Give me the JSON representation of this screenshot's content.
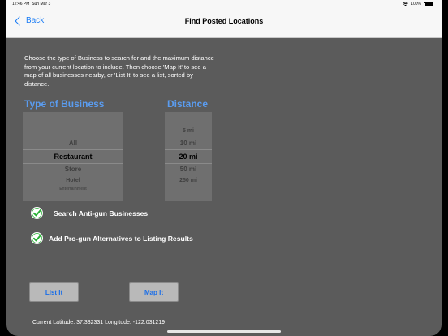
{
  "status_bar": {
    "time": "12:46 PM",
    "date": "Sun Mar 3",
    "wifi_icon": "wifi-icon",
    "battery_percent": "100%"
  },
  "nav": {
    "back_label": "Back",
    "title": "Find Posted Locations"
  },
  "instructions": "Choose the type of Business to search for and the maximum distance from your current location to include.  Then choose 'Map It' to see a map of all businesses nearby, or 'List It' to see a list, sorted by distance.",
  "business_picker": {
    "label": "Type of Business",
    "items": [
      "All",
      "Restaurant",
      "Store",
      "Hotel",
      "Entertainment"
    ],
    "selected": "Restaurant"
  },
  "distance_picker": {
    "label": "Distance",
    "items": [
      "5 mi",
      "10 mi",
      "20 mi",
      "50 mi",
      "250 mi"
    ],
    "selected": "20 mi"
  },
  "options": {
    "anti_gun_label": "Search Anti-gun Businesses",
    "anti_gun_checked": true,
    "pro_gun_label": "Add Pro-gun Alternatives to Listing Results",
    "pro_gun_checked": true
  },
  "buttons": {
    "list_label": "List It",
    "map_label": "Map It"
  },
  "location": {
    "text": "Current Latitude: 37.332331 Longitude: -122.031219"
  },
  "colors": {
    "accent_blue": "#1a7cf5",
    "label_blue": "#5a9cf0",
    "check_green": "#27b034",
    "background": "#5b5b5b"
  }
}
